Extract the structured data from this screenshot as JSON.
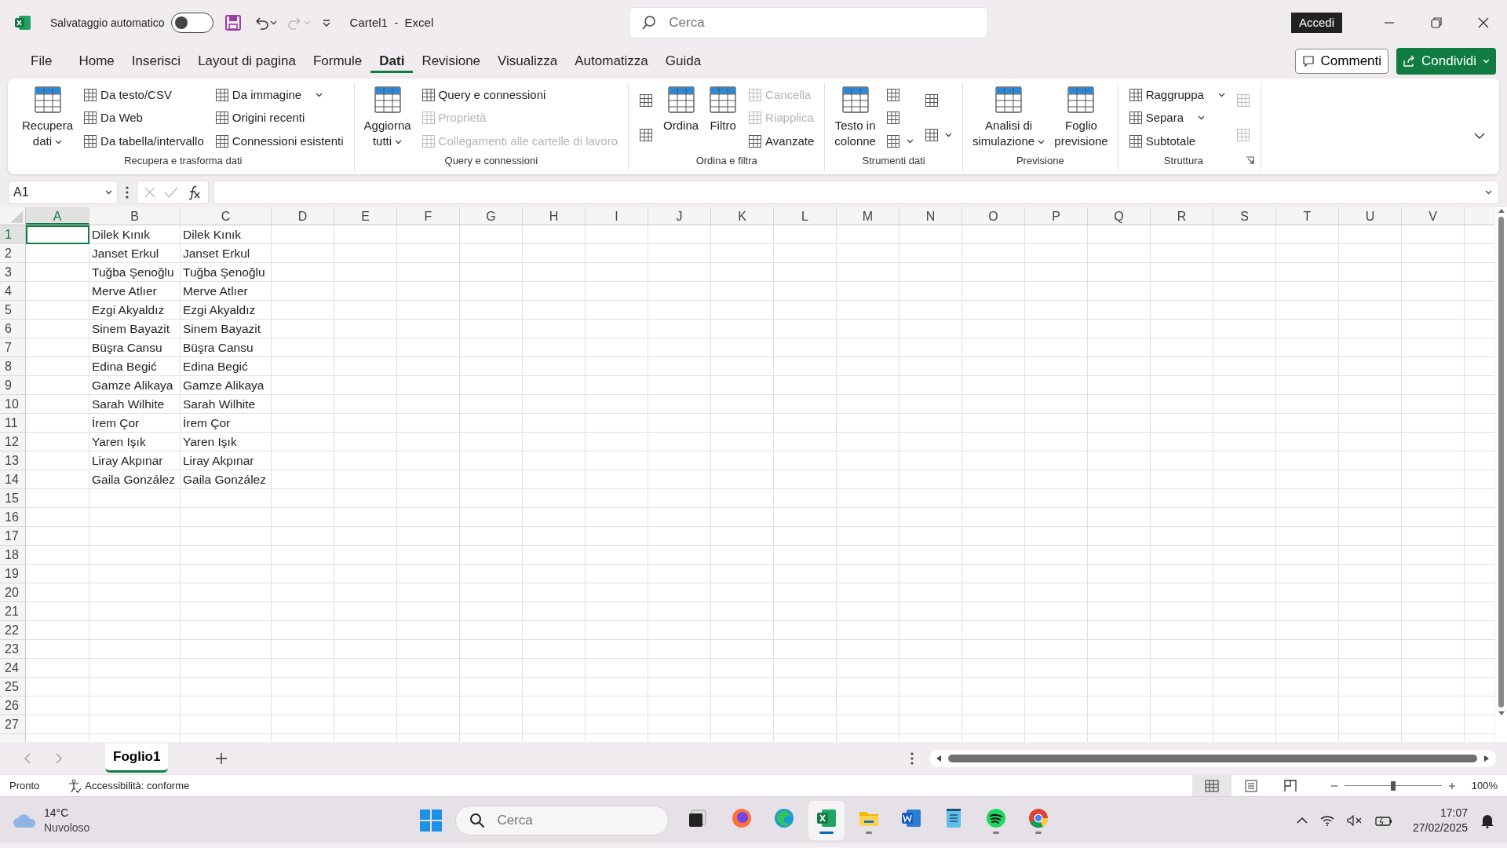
{
  "title_bar": {
    "autosave_label": "Salvataggio automatico",
    "autosave_on": false,
    "redo_disabled": true,
    "title": "Cartel1  -  Excel",
    "search_placeholder": "Cerca",
    "sign_in": "Accedi"
  },
  "menu_tabs": [
    {
      "label": "File",
      "selected": false
    },
    {
      "label": "Home",
      "selected": false
    },
    {
      "label": "Inserisci",
      "selected": false
    },
    {
      "label": "Layout di pagina",
      "selected": false
    },
    {
      "label": "Formule",
      "selected": false
    },
    {
      "label": "Dati",
      "selected": true
    },
    {
      "label": "Revisione",
      "selected": false
    },
    {
      "label": "Visualizza",
      "selected": false
    },
    {
      "label": "Automatizza",
      "selected": false
    },
    {
      "label": "Guida",
      "selected": false
    }
  ],
  "comments_button": "Commenti",
  "share_button": "Condividi",
  "ribbon_groups": [
    {
      "label": "Recupera e trasforma dati",
      "launcher": false,
      "columns": [
        {
          "kind": "large",
          "lines": [
            "Recupera",
            "dati"
          ],
          "dropdown": true,
          "disabled": false
        },
        {
          "kind": "stack",
          "items": [
            {
              "label": "Da testo/CSV",
              "dropdown": false,
              "disabled": false
            },
            {
              "label": "Da Web",
              "dropdown": false,
              "disabled": false
            },
            {
              "label": "Da tabella/intervallo",
              "dropdown": false,
              "disabled": false
            }
          ]
        },
        {
          "kind": "stack",
          "items": [
            {
              "label": "Da immagine",
              "dropdown": true,
              "disabled": false
            },
            {
              "label": "Origini recenti",
              "dropdown": false,
              "disabled": false
            },
            {
              "label": "Connessioni esistenti",
              "dropdown": false,
              "disabled": false
            }
          ]
        }
      ]
    },
    {
      "label": "Query e connessioni",
      "launcher": false,
      "columns": [
        {
          "kind": "large",
          "lines": [
            "Aggiorna",
            "tutti"
          ],
          "dropdown": true,
          "disabled": false
        },
        {
          "kind": "stack",
          "items": [
            {
              "label": "Query e connessioni",
              "dropdown": false,
              "disabled": false
            },
            {
              "label": "Proprietà",
              "dropdown": false,
              "disabled": true
            },
            {
              "label": "Collegamenti alle cartelle di lavoro",
              "dropdown": false,
              "disabled": true
            }
          ]
        }
      ]
    },
    {
      "label": "Ordina e filtra",
      "launcher": false,
      "columns": [
        {
          "kind": "stack",
          "items": [
            {
              "dropdown": false,
              "disabled": false
            },
            {
              "dropdown": false,
              "disabled": false
            }
          ]
        },
        {
          "kind": "large",
          "lines": [
            "Ordina"
          ],
          "dropdown": false,
          "disabled": false
        },
        {
          "kind": "large",
          "lines": [
            "Filtro"
          ],
          "dropdown": false,
          "disabled": false
        },
        {
          "kind": "stack",
          "items": [
            {
              "label": "Cancella",
              "dropdown": false,
              "disabled": true
            },
            {
              "label": "Riapplica",
              "dropdown": false,
              "disabled": true
            },
            {
              "label": "Avanzate",
              "dropdown": false,
              "disabled": false
            }
          ]
        }
      ]
    },
    {
      "label": "Strumenti dati",
      "launcher": false,
      "columns": [
        {
          "kind": "large",
          "lines": [
            "Testo in",
            "colonne"
          ],
          "dropdown": false,
          "disabled": false
        },
        {
          "kind": "stack",
          "items": [
            {
              "dropdown": false,
              "disabled": false
            },
            {
              "dropdown": false,
              "disabled": false
            },
            {
              "dropdown": true,
              "disabled": false
            }
          ]
        },
        {
          "kind": "stack",
          "items": [
            {
              "dropdown": false,
              "disabled": false
            },
            {
              "dropdown": true,
              "disabled": false
            }
          ]
        }
      ]
    },
    {
      "label": "Previsione",
      "launcher": false,
      "columns": [
        {
          "kind": "large",
          "lines": [
            "Analisi di",
            "simulazione"
          ],
          "dropdown": true,
          "disabled": false
        },
        {
          "kind": "large",
          "lines": [
            "Foglio",
            "previsione"
          ],
          "dropdown": false,
          "disabled": false
        }
      ]
    },
    {
      "label": "Struttura",
      "launcher": true,
      "columns": [
        {
          "kind": "stack",
          "items": [
            {
              "label": "Raggruppa",
              "dropdown": true,
              "disabled": false
            },
            {
              "label": "Separa",
              "dropdown": true,
              "disabled": false
            },
            {
              "label": "Subtotale",
              "dropdown": false,
              "disabled": false
            }
          ]
        },
        {
          "kind": "stack",
          "items": [
            {
              "dropdown": false,
              "disabled": true
            },
            {
              "dropdown": false,
              "disabled": true
            }
          ]
        }
      ]
    }
  ],
  "formula_bar": {
    "name_box": "A1"
  },
  "columns": [
    {
      "label": "A",
      "selected": true
    },
    {
      "label": "B",
      "selected": false
    },
    {
      "label": "C",
      "selected": false
    },
    {
      "label": "D",
      "selected": false
    },
    {
      "label": "E",
      "selected": false
    },
    {
      "label": "F",
      "selected": false
    },
    {
      "label": "G",
      "selected": false
    },
    {
      "label": "H",
      "selected": false
    },
    {
      "label": "I",
      "selected": false
    },
    {
      "label": "J",
      "selected": false
    },
    {
      "label": "K",
      "selected": false
    },
    {
      "label": "L",
      "selected": false
    },
    {
      "label": "M",
      "selected": false
    },
    {
      "label": "N",
      "selected": false
    },
    {
      "label": "O",
      "selected": false
    },
    {
      "label": "P",
      "selected": false
    },
    {
      "label": "Q",
      "selected": false
    },
    {
      "label": "R",
      "selected": false
    },
    {
      "label": "S",
      "selected": false
    },
    {
      "label": "T",
      "selected": false
    },
    {
      "label": "U",
      "selected": false
    },
    {
      "label": "V",
      "selected": false
    }
  ],
  "rows": [
    {
      "number": "1",
      "selected": true,
      "column_b": "Dilek Kınık",
      "column_c": "Dilek Kınık"
    },
    {
      "number": "2",
      "selected": false,
      "column_b": "Janset Erkul",
      "column_c": "Janset Erkul"
    },
    {
      "number": "3",
      "selected": false,
      "column_b": "Tuğba Şenoğlu",
      "column_c": "Tuğba Şenoğlu"
    },
    {
      "number": "4",
      "selected": false,
      "column_b": "Merve Atlıer",
      "column_c": "Merve Atlıer"
    },
    {
      "number": "5",
      "selected": false,
      "column_b": "Ezgi Akyaldız",
      "column_c": "Ezgi Akyaldız"
    },
    {
      "number": "6",
      "selected": false,
      "column_b": "Sinem Bayazit",
      "column_c": "Sinem Bayazit"
    },
    {
      "number": "7",
      "selected": false,
      "column_b": "Büşra Cansu",
      "column_c": "Büşra Cansu"
    },
    {
      "number": "8",
      "selected": false,
      "column_b": "Edina Begić",
      "column_c": "Edina Begić"
    },
    {
      "number": "9",
      "selected": false,
      "column_b": "Gamze Alikaya",
      "column_c": "Gamze Alikaya"
    },
    {
      "number": "10",
      "selected": false,
      "column_b": "Sarah Wilhite",
      "column_c": "Sarah Wilhite"
    },
    {
      "number": "11",
      "selected": false,
      "column_b": "İrem Çor",
      "column_c": "İrem Çor"
    },
    {
      "number": "12",
      "selected": false,
      "column_b": "Yaren Işık",
      "column_c": "Yaren Işık"
    },
    {
      "number": "13",
      "selected": false,
      "column_b": "Liray Akpınar",
      "column_c": "Liray Akpınar"
    },
    {
      "number": "14",
      "selected": false,
      "column_b": "Gaila González",
      "column_c": "Gaila González"
    },
    {
      "number": "15",
      "selected": false
    },
    {
      "number": "16",
      "selected": false
    },
    {
      "number": "17",
      "selected": false
    },
    {
      "number": "18",
      "selected": false
    },
    {
      "number": "19",
      "selected": false
    },
    {
      "number": "20",
      "selected": false
    },
    {
      "number": "21",
      "selected": false
    },
    {
      "number": "22",
      "selected": false
    },
    {
      "number": "23",
      "selected": false
    },
    {
      "number": "24",
      "selected": false
    },
    {
      "number": "25",
      "selected": false
    },
    {
      "number": "26",
      "selected": false
    },
    {
      "number": "27",
      "selected": false
    }
  ],
  "sheet_tabs": [
    {
      "label": "Foglio1",
      "selected": true
    }
  ],
  "status_bar": {
    "ready": "Pronto",
    "accessibility": "Accessibilità: conforme",
    "views": [
      {
        "kind": "normal",
        "selected": true
      },
      {
        "kind": "page-layout",
        "selected": false
      },
      {
        "kind": "page-break",
        "selected": false
      }
    ],
    "zoom": {
      "level": 0.5,
      "reading": "100%"
    }
  },
  "taskbar": {
    "weather": {
      "temperature": "14°C",
      "condition": "Nuvoloso"
    },
    "search_placeholder": "Cerca",
    "apps": [
      {
        "kind": "task-view",
        "running": false,
        "active": false
      },
      {
        "kind": "firefox",
        "running": false,
        "active": false
      },
      {
        "kind": "edge",
        "running": false,
        "active": false
      },
      {
        "kind": "excel",
        "running": true,
        "active": true
      },
      {
        "kind": "files",
        "running": true,
        "active": false
      },
      {
        "kind": "word",
        "running": false,
        "active": false
      },
      {
        "kind": "notepad",
        "running": false,
        "active": false
      },
      {
        "kind": "spotify",
        "running": true,
        "active": false
      },
      {
        "kind": "chrome",
        "running": true,
        "active": false
      }
    ],
    "clock": {
      "time": "17:07",
      "date": "27/02/2025"
    }
  }
}
